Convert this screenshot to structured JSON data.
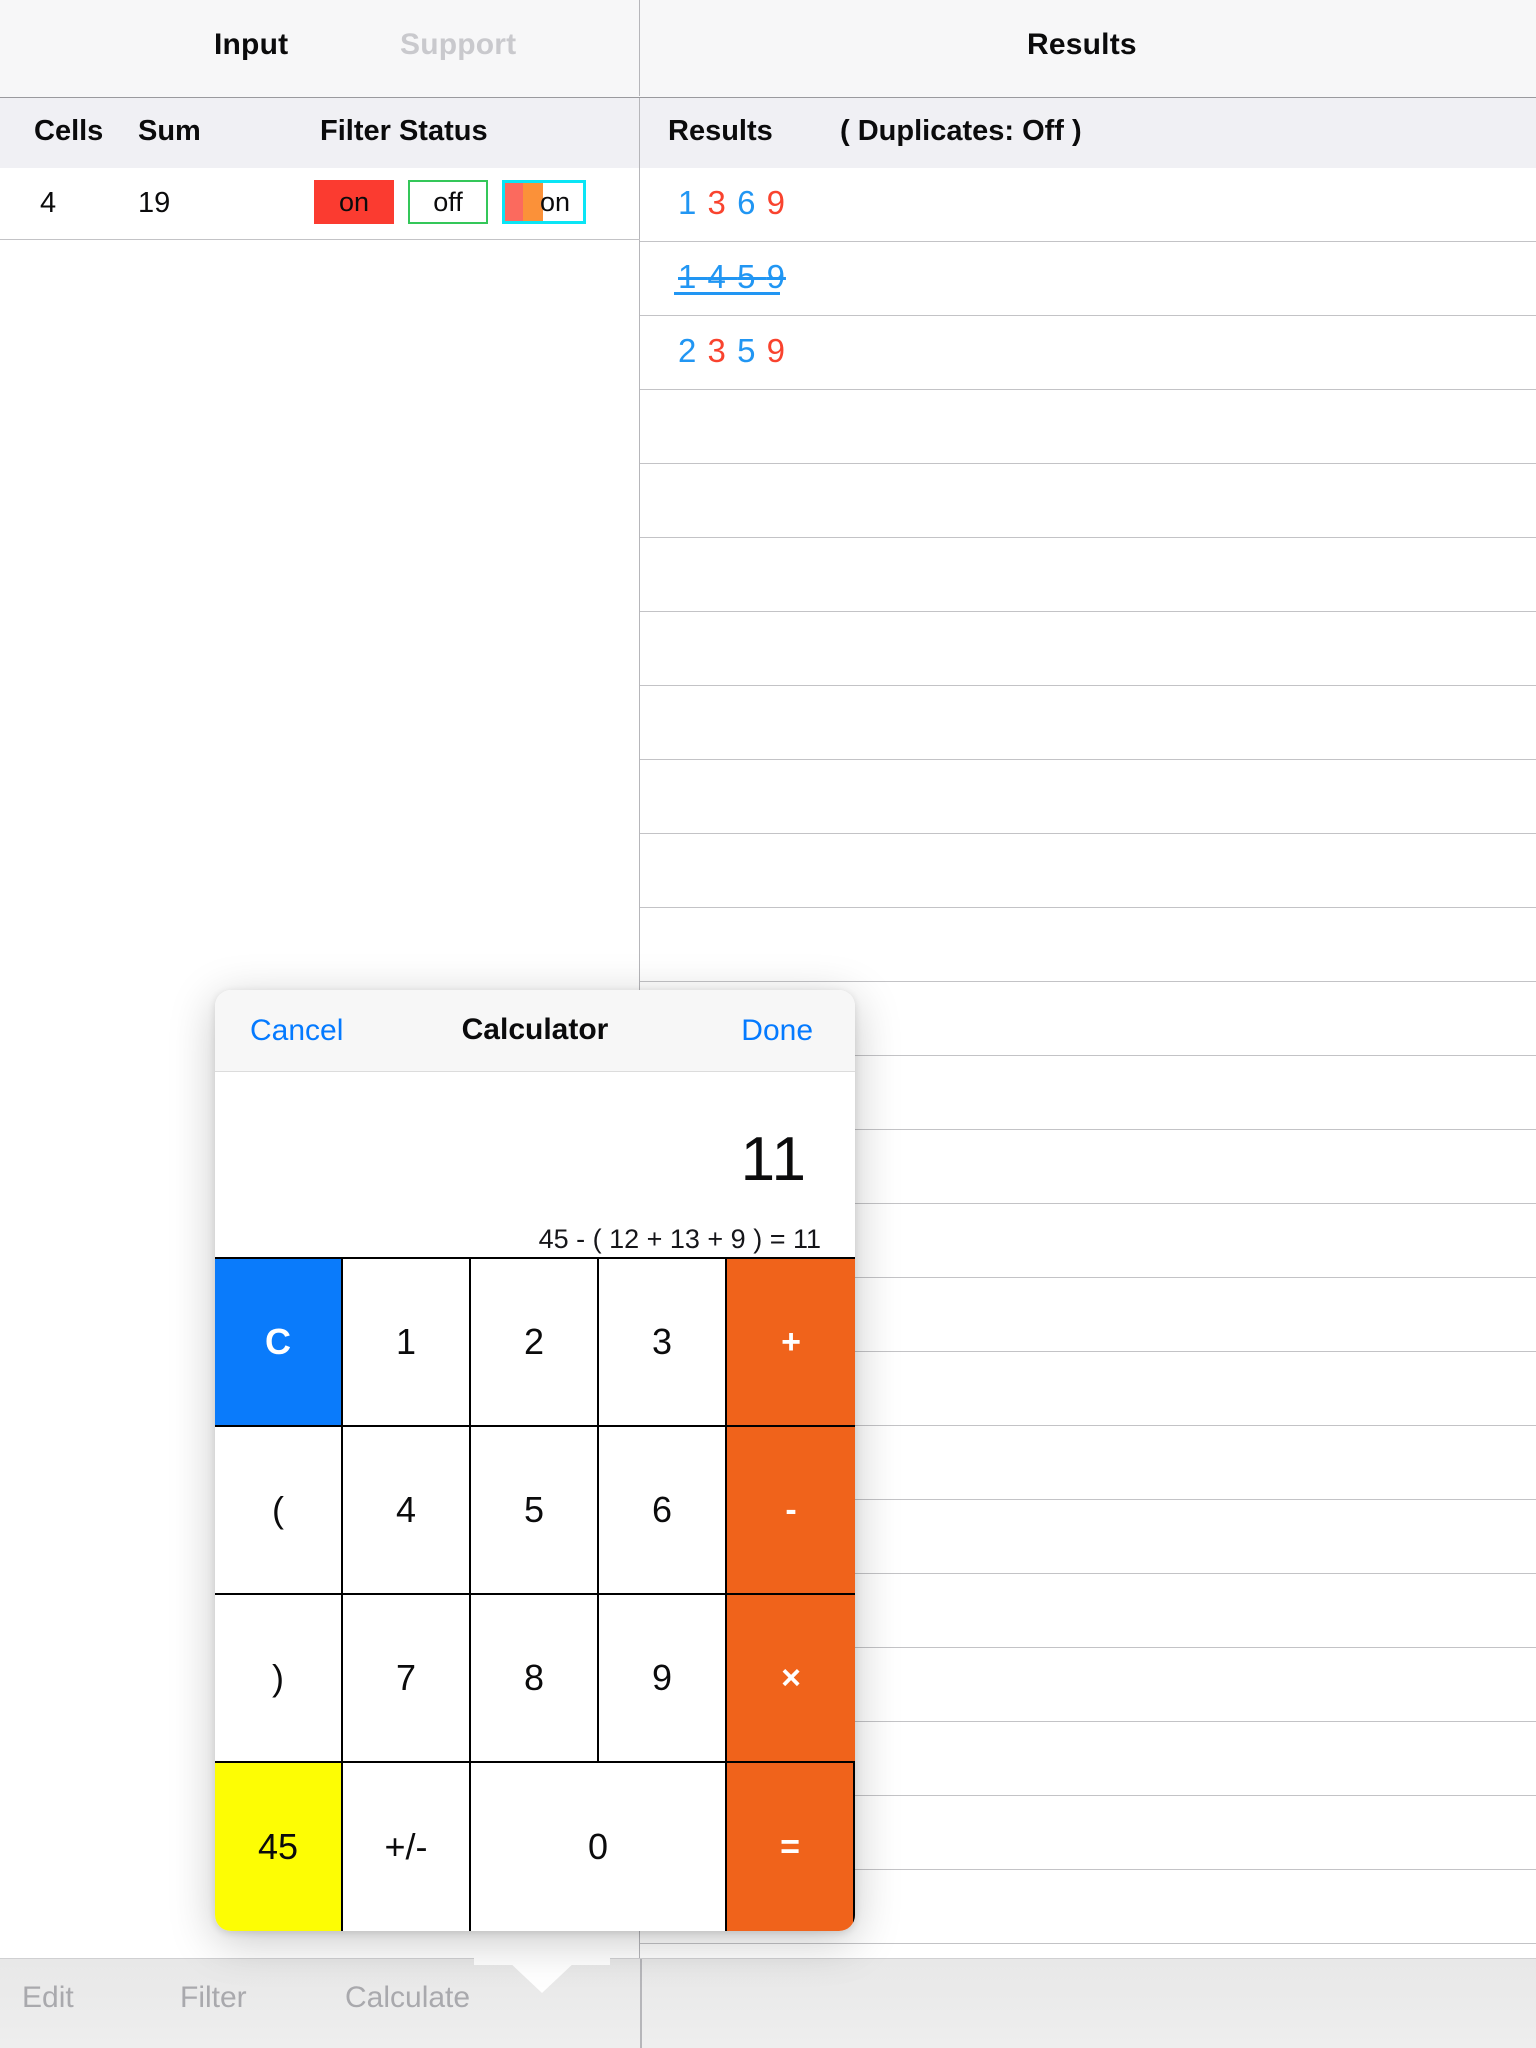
{
  "topbar": {
    "tabs": [
      {
        "label": "Input",
        "active": true
      },
      {
        "label": "Support",
        "active": false
      },
      {
        "label": "Results",
        "active": true
      }
    ]
  },
  "left_panel": {
    "columns": {
      "cells": "Cells",
      "sum": "Sum",
      "filter_status": "Filter Status"
    },
    "row": {
      "cells": "4",
      "sum": "19",
      "badges": [
        {
          "label": "on",
          "style": "solid-red",
          "fill": "#fb3b30",
          "border": "#fb3b30",
          "text_color": "#0b0b0c"
        },
        {
          "label": "off",
          "style": "outline-green",
          "fill": "#ffffff",
          "border": "#34c759",
          "text_color": "#0b0b0c"
        },
        {
          "label": "on",
          "style": "outline-cyan-stripe",
          "fill": "#ffffff",
          "border": "#0ae5f5",
          "stripe_a": "#fb6a5e",
          "stripe_b": "#fb9139",
          "text_color": "#0b0b0c"
        }
      ]
    }
  },
  "right_panel": {
    "header": {
      "results_label": "Results",
      "duplicates_label": "( Duplicates:  Off )"
    },
    "rows": [
      {
        "digits": [
          "1",
          "3",
          "6",
          "9"
        ],
        "colors": [
          "blue",
          "red",
          "blue",
          "red"
        ],
        "struck": false
      },
      {
        "digits": [
          "1",
          "4",
          "5",
          "9"
        ],
        "colors": [
          "blue",
          "blue",
          "blue",
          "blue"
        ],
        "struck": true
      },
      {
        "digits": [
          "2",
          "3",
          "5",
          "9"
        ],
        "colors": [
          "blue",
          "red",
          "blue",
          "red"
        ],
        "struck": false
      },
      {
        "digits": [],
        "colors": [],
        "struck": false
      },
      {
        "digits": [],
        "colors": [],
        "struck": false
      },
      {
        "digits": [],
        "colors": [],
        "struck": false
      },
      {
        "digits": [],
        "colors": [],
        "struck": false
      },
      {
        "digits": [],
        "colors": [],
        "struck": false
      },
      {
        "digits": [],
        "colors": [],
        "struck": false
      },
      {
        "digits": [],
        "colors": [],
        "struck": false
      },
      {
        "digits": [],
        "colors": [],
        "struck": false
      },
      {
        "digits": [],
        "colors": [],
        "struck": false
      },
      {
        "digits": [],
        "colors": [],
        "struck": false
      },
      {
        "digits": [],
        "colors": [],
        "struck": false
      },
      {
        "digits": [],
        "colors": [],
        "struck": false
      },
      {
        "digits": [],
        "colors": [],
        "struck": false
      },
      {
        "digits": [],
        "colors": [],
        "struck": false
      },
      {
        "digits": [],
        "colors": [],
        "struck": false
      },
      {
        "digits": [],
        "colors": [],
        "struck": false
      },
      {
        "digits": [],
        "colors": [],
        "struck": false
      },
      {
        "digits": [],
        "colors": [],
        "struck": false
      },
      {
        "digits": [],
        "colors": [],
        "struck": false
      },
      {
        "digits": [],
        "colors": [],
        "struck": false
      },
      {
        "digits": [],
        "colors": [],
        "struck": false
      }
    ]
  },
  "calculator": {
    "cancel_label": "Cancel",
    "title": "Calculator",
    "done_label": "Done",
    "display_value": "11",
    "expression": "45 - ( 12 + 13 + 9 ) = 11",
    "keys": [
      {
        "label": "C",
        "kind": "clear",
        "name": "key-clear"
      },
      {
        "label": "1",
        "kind": "digit",
        "name": "key-1"
      },
      {
        "label": "2",
        "kind": "digit",
        "name": "key-2"
      },
      {
        "label": "3",
        "kind": "digit",
        "name": "key-3"
      },
      {
        "label": "+",
        "kind": "op",
        "name": "key-plus"
      },
      {
        "label": "(",
        "kind": "paren",
        "name": "key-open-paren"
      },
      {
        "label": "4",
        "kind": "digit",
        "name": "key-4"
      },
      {
        "label": "5",
        "kind": "digit",
        "name": "key-5"
      },
      {
        "label": "6",
        "kind": "digit",
        "name": "key-6"
      },
      {
        "label": "-",
        "kind": "op",
        "name": "key-minus"
      },
      {
        "label": ")",
        "kind": "paren",
        "name": "key-close-paren"
      },
      {
        "label": "7",
        "kind": "digit",
        "name": "key-7"
      },
      {
        "label": "8",
        "kind": "digit",
        "name": "key-8"
      },
      {
        "label": "9",
        "kind": "digit",
        "name": "key-9"
      },
      {
        "label": "×",
        "kind": "op",
        "name": "key-multiply"
      },
      {
        "label": "45",
        "kind": "memory",
        "name": "key-memory-45"
      },
      {
        "label": "+/-",
        "kind": "sign",
        "name": "key-sign-toggle"
      },
      {
        "label": "0",
        "kind": "zero",
        "name": "key-0"
      },
      {
        "label": "=",
        "kind": "op",
        "name": "key-equals"
      }
    ],
    "colors": {
      "clear_bg": "#0a7bfb",
      "op_bg": "#f0631b",
      "memory_bg": "#fdfd04",
      "accent_blue": "#047aff"
    }
  },
  "bottombar": {
    "items": [
      {
        "label": "Edit",
        "name": "toolbar-edit"
      },
      {
        "label": "Filter",
        "name": "toolbar-filter"
      },
      {
        "label": "Calculate",
        "name": "toolbar-calculate"
      }
    ]
  }
}
